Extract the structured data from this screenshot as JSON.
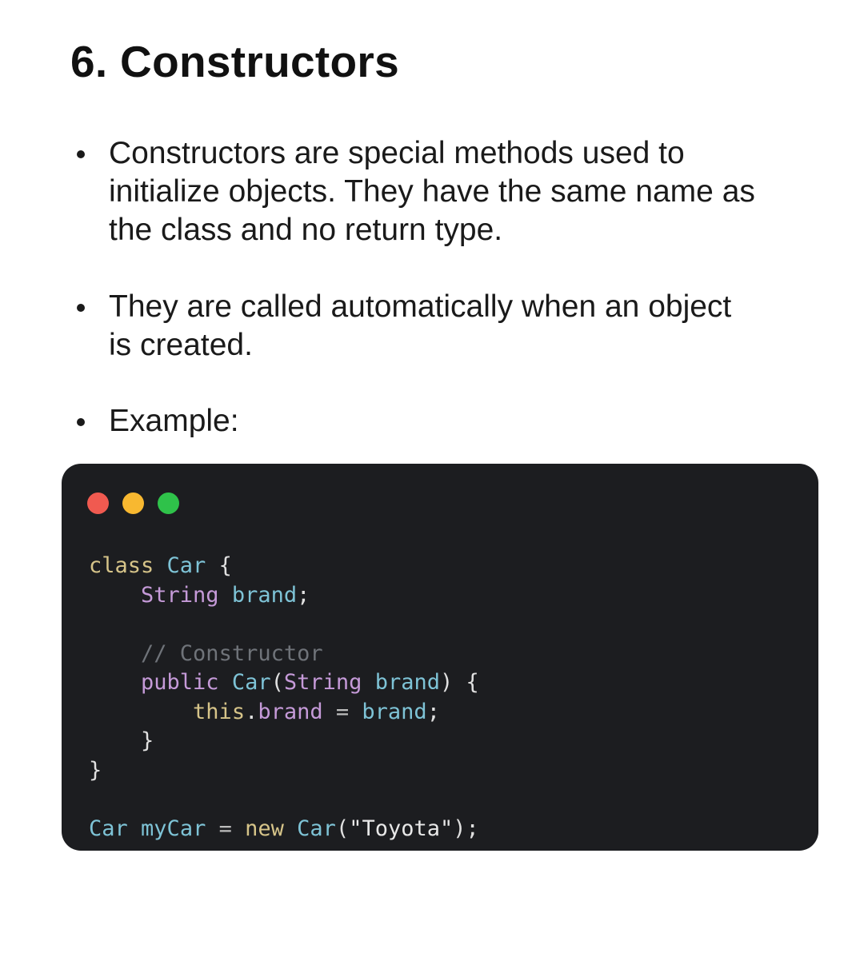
{
  "title": "6. Constructors",
  "bullets": [
    "Constructors are special methods used to\ninitialize objects. They have the same name as\nthe class and no return type.",
    "They are called automatically when an object\nis created.",
    "Example:"
  ],
  "code_window": {
    "traffic_lights": [
      "#f05a50",
      "#f8b830",
      "#2fc24a"
    ],
    "lines": [
      [
        [
          "class",
          "kw"
        ],
        [
          " ",
          "punct"
        ],
        [
          "Car",
          "class"
        ],
        [
          " {",
          "punct"
        ]
      ],
      [
        [
          "    ",
          "punct"
        ],
        [
          "String",
          "type"
        ],
        [
          " ",
          "punct"
        ],
        [
          "brand",
          "ident"
        ],
        [
          ";",
          "punct"
        ]
      ],
      [],
      [
        [
          "    ",
          "punct"
        ],
        [
          "// Constructor",
          "comment"
        ]
      ],
      [
        [
          "    ",
          "punct"
        ],
        [
          "public",
          "type"
        ],
        [
          " ",
          "punct"
        ],
        [
          "Car",
          "ident"
        ],
        [
          "(",
          "punct"
        ],
        [
          "String",
          "type"
        ],
        [
          " ",
          "punct"
        ],
        [
          "brand",
          "ident"
        ],
        [
          ") {",
          "punct"
        ]
      ],
      [
        [
          "        ",
          "punct"
        ],
        [
          "this",
          "this"
        ],
        [
          ".",
          "punct"
        ],
        [
          "brand",
          "field"
        ],
        [
          " = ",
          "op"
        ],
        [
          "brand",
          "ident"
        ],
        [
          ";",
          "punct"
        ]
      ],
      [
        [
          "    ",
          "punct"
        ],
        [
          "}",
          "punct"
        ]
      ],
      [
        [
          "}",
          "punct"
        ]
      ],
      [],
      [
        [
          "Car",
          "ident"
        ],
        [
          " ",
          "punct"
        ],
        [
          "myCar",
          "ident"
        ],
        [
          " = ",
          "op"
        ],
        [
          "new",
          "new"
        ],
        [
          " ",
          "punct"
        ],
        [
          "Car",
          "ident"
        ],
        [
          "(",
          "punct"
        ],
        [
          "\"Toyota\"",
          "str"
        ],
        [
          ");",
          "punct"
        ]
      ]
    ]
  }
}
